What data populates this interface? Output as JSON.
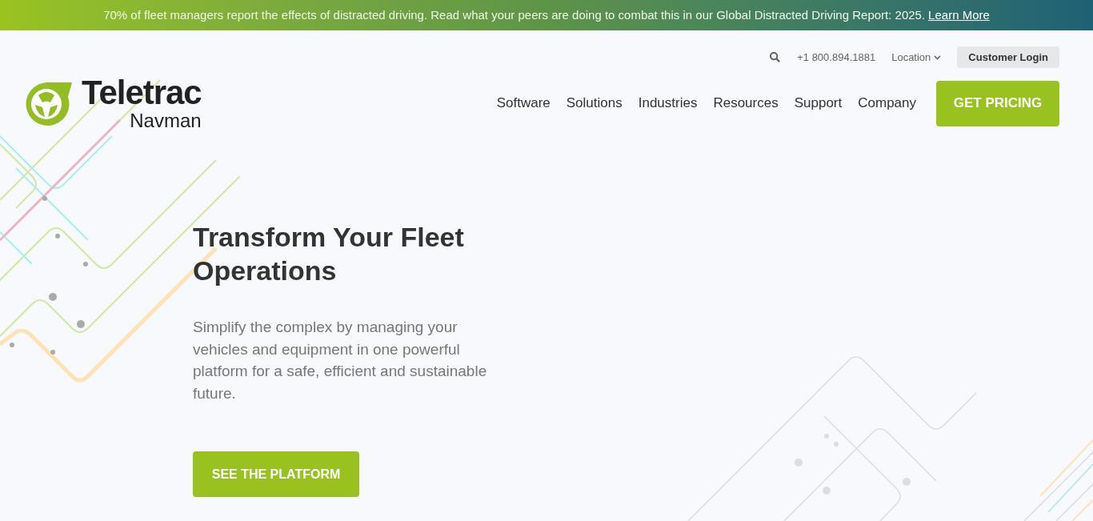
{
  "banner": {
    "text": "70% of fleet managers report the effects of distracted driving. Read what your peers are doing to combat this in our Global Distracted Driving Report: 2025.",
    "link": "Learn More"
  },
  "utility_bar": {
    "phone": "+1 800.894.1881",
    "location": "Location",
    "login": "Customer Login"
  },
  "logo": {
    "line1": "Teletrac",
    "line2": "Navman"
  },
  "nav": [
    "Software",
    "Solutions",
    "Industries",
    "Resources",
    "Support",
    "Company"
  ],
  "cta": "GET PRICING",
  "hero": {
    "title": "Transform Your Fleet Operations",
    "body": "Simplify the complex by managing your vehicles and equipment in one powerful platform for a safe, efficient and sustainable future.",
    "button": "SEE THE PLATFORM"
  }
}
